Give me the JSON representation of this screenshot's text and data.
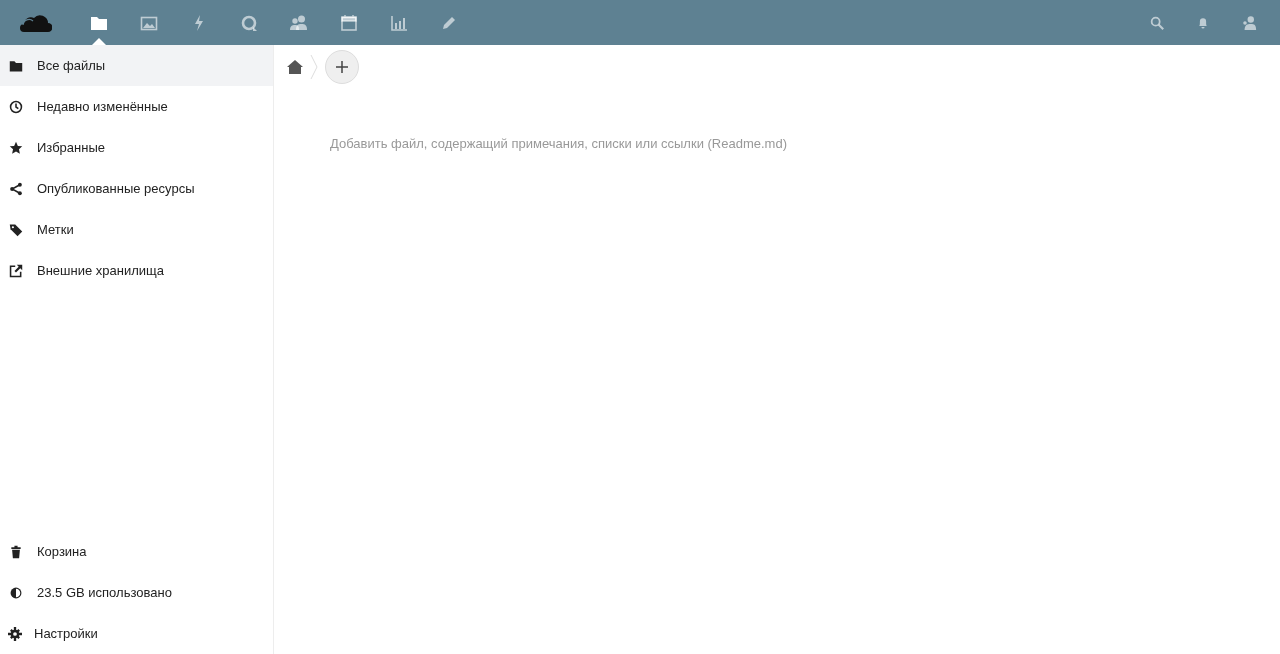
{
  "header": {
    "apps": [
      {
        "selected": true
      },
      {
        "selected": false
      },
      {
        "selected": false
      },
      {
        "selected": false
      },
      {
        "selected": false
      },
      {
        "selected": false
      },
      {
        "selected": false
      },
      {
        "selected": false
      }
    ]
  },
  "sidebar": {
    "items": [
      {
        "label": "Все файлы",
        "selected": true
      },
      {
        "label": "Недавно изменённые",
        "selected": false
      },
      {
        "label": "Избранные",
        "selected": false
      },
      {
        "label": "Опубликованные ресурсы",
        "selected": false
      },
      {
        "label": "Метки",
        "selected": false
      },
      {
        "label": "Внешние хранилища",
        "selected": false
      }
    ],
    "footer": [
      {
        "label": "Корзина"
      },
      {
        "label": "23.5 GB использовано"
      },
      {
        "label": "Настройки"
      }
    ]
  },
  "content": {
    "hint": "Добавить файл, содержащий примечания, списки или ссылки (Readme.md)"
  }
}
